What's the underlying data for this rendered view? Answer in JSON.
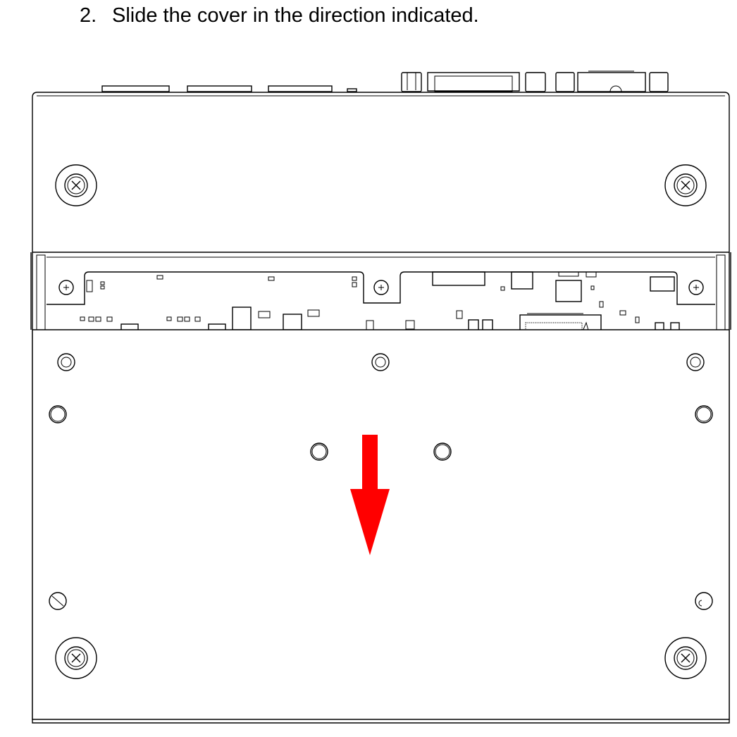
{
  "instruction": {
    "step_number": "2.",
    "text": "Slide the cover in the direction indicated."
  },
  "arrow": {
    "color": "#ff0000",
    "direction": "down"
  },
  "icons": {
    "cover": "cover-plate",
    "screw": "captive-screw-icon",
    "standoff": "standoff-hole-icon",
    "arrow": "slide-direction-arrow-icon"
  }
}
